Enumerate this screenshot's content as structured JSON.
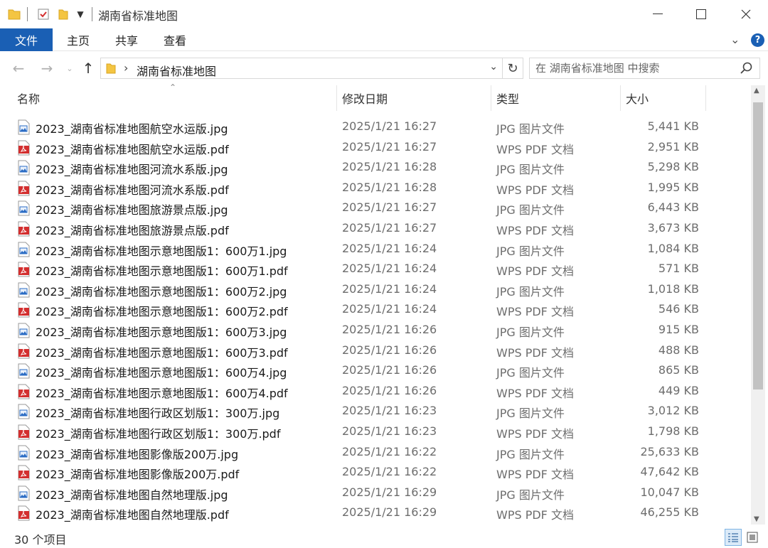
{
  "window": {
    "title": "湖南省标准地图"
  },
  "ribbon": {
    "tabs": [
      "文件",
      "主页",
      "共享",
      "查看"
    ]
  },
  "address": {
    "crumb": "湖南省标准地图",
    "search_placeholder": "在 湖南省标准地图 中搜索"
  },
  "columns": {
    "name": "名称",
    "date": "修改日期",
    "type": "类型",
    "size": "大小"
  },
  "files": [
    {
      "name": "2023_湖南省标准地图航空水运版.jpg",
      "date": "2025/1/21 16:27",
      "type": "JPG 图片文件",
      "size": "5,441 KB",
      "kind": "jpg"
    },
    {
      "name": "2023_湖南省标准地图航空水运版.pdf",
      "date": "2025/1/21 16:27",
      "type": "WPS PDF 文档",
      "size": "2,951 KB",
      "kind": "pdf"
    },
    {
      "name": "2023_湖南省标准地图河流水系版.jpg",
      "date": "2025/1/21 16:28",
      "type": "JPG 图片文件",
      "size": "5,298 KB",
      "kind": "jpg"
    },
    {
      "name": "2023_湖南省标准地图河流水系版.pdf",
      "date": "2025/1/21 16:28",
      "type": "WPS PDF 文档",
      "size": "1,995 KB",
      "kind": "pdf"
    },
    {
      "name": "2023_湖南省标准地图旅游景点版.jpg",
      "date": "2025/1/21 16:27",
      "type": "JPG 图片文件",
      "size": "6,443 KB",
      "kind": "jpg"
    },
    {
      "name": "2023_湖南省标准地图旅游景点版.pdf",
      "date": "2025/1/21 16:27",
      "type": "WPS PDF 文档",
      "size": "3,673 KB",
      "kind": "pdf"
    },
    {
      "name": "2023_湖南省标准地图示意地图版1：600万1.jpg",
      "date": "2025/1/21 16:24",
      "type": "JPG 图片文件",
      "size": "1,084 KB",
      "kind": "jpg"
    },
    {
      "name": "2023_湖南省标准地图示意地图版1：600万1.pdf",
      "date": "2025/1/21 16:24",
      "type": "WPS PDF 文档",
      "size": "571 KB",
      "kind": "pdf"
    },
    {
      "name": "2023_湖南省标准地图示意地图版1：600万2.jpg",
      "date": "2025/1/21 16:24",
      "type": "JPG 图片文件",
      "size": "1,018 KB",
      "kind": "jpg"
    },
    {
      "name": "2023_湖南省标准地图示意地图版1：600万2.pdf",
      "date": "2025/1/21 16:24",
      "type": "WPS PDF 文档",
      "size": "546 KB",
      "kind": "pdf"
    },
    {
      "name": "2023_湖南省标准地图示意地图版1：600万3.jpg",
      "date": "2025/1/21 16:26",
      "type": "JPG 图片文件",
      "size": "915 KB",
      "kind": "jpg"
    },
    {
      "name": "2023_湖南省标准地图示意地图版1：600万3.pdf",
      "date": "2025/1/21 16:26",
      "type": "WPS PDF 文档",
      "size": "488 KB",
      "kind": "pdf"
    },
    {
      "name": "2023_湖南省标准地图示意地图版1：600万4.jpg",
      "date": "2025/1/21 16:26",
      "type": "JPG 图片文件",
      "size": "865 KB",
      "kind": "jpg"
    },
    {
      "name": "2023_湖南省标准地图示意地图版1：600万4.pdf",
      "date": "2025/1/21 16:26",
      "type": "WPS PDF 文档",
      "size": "449 KB",
      "kind": "pdf"
    },
    {
      "name": "2023_湖南省标准地图行政区划版1：300万.jpg",
      "date": "2025/1/21 16:23",
      "type": "JPG 图片文件",
      "size": "3,012 KB",
      "kind": "jpg"
    },
    {
      "name": "2023_湖南省标准地图行政区划版1：300万.pdf",
      "date": "2025/1/21 16:23",
      "type": "WPS PDF 文档",
      "size": "1,798 KB",
      "kind": "pdf"
    },
    {
      "name": "2023_湖南省标准地图影像版200万.jpg",
      "date": "2025/1/21 16:22",
      "type": "JPG 图片文件",
      "size": "25,633 KB",
      "kind": "jpg"
    },
    {
      "name": "2023_湖南省标准地图影像版200万.pdf",
      "date": "2025/1/21 16:22",
      "type": "WPS PDF 文档",
      "size": "47,642 KB",
      "kind": "pdf"
    },
    {
      "name": "2023_湖南省标准地图自然地理版.jpg",
      "date": "2025/1/21 16:29",
      "type": "JPG 图片文件",
      "size": "10,047 KB",
      "kind": "jpg"
    },
    {
      "name": "2023_湖南省标准地图自然地理版.pdf",
      "date": "2025/1/21 16:29",
      "type": "WPS PDF 文档",
      "size": "46,255 KB",
      "kind": "pdf"
    }
  ],
  "status": {
    "count": "30 个项目"
  },
  "colors": {
    "accent": "#1a5fb4",
    "pdf_red": "#d32f2f",
    "jpg_blue": "#2b6cc4",
    "folder_yellow": "#f4c542"
  },
  "icons": [
    "folder-icon",
    "properties-icon",
    "new-folder-icon",
    "dropdown-icon",
    "minimize-icon",
    "maximize-icon",
    "close-icon",
    "help-icon",
    "back-icon",
    "forward-icon",
    "up-icon",
    "refresh-icon",
    "search-icon",
    "jpg-file-icon",
    "pdf-file-icon",
    "details-view-icon",
    "thumbnail-view-icon"
  ]
}
